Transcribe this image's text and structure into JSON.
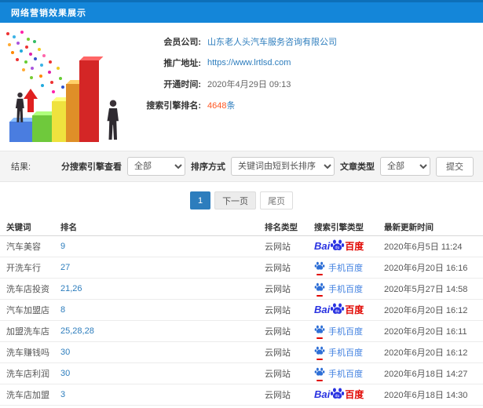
{
  "header": {
    "title": "网络营销效果展示"
  },
  "info": {
    "fields": [
      {
        "label": "会员公司:",
        "value": "山东老人头汽车服务咨询有限公司"
      },
      {
        "label": "推广地址:",
        "value": "https://www.lrtlsd.com"
      },
      {
        "label": "开通时间:",
        "value": "2020年4月29日 09:13"
      },
      {
        "label": "搜索引擎排名:",
        "value": "4648",
        "suffix": "条"
      }
    ]
  },
  "illustration": {
    "name": "3d-bar-chart-growth",
    "bar_colors": [
      "#4a7de0",
      "#6fc93c",
      "#efe23e",
      "#df8f28",
      "#d42626"
    ]
  },
  "filters": {
    "result_label": "结果:",
    "engine_label": "分搜索引擎查看",
    "engine_value": "全部",
    "sort_label": "排序方式",
    "sort_value": "关键词由短到长排序",
    "article_label": "文章类型",
    "article_value": "全部",
    "submit_label": "提交"
  },
  "pagination": {
    "current": "1",
    "next": "下一页",
    "last": "尾页"
  },
  "table": {
    "headers": [
      "关键词",
      "排名",
      "排名类型",
      "搜索引擎类型",
      "最新更新时间"
    ],
    "engine_labels": {
      "baidu_bai": "Bai",
      "baidu_du": "du",
      "baidu_cn": "百度",
      "mobile_cn": "手机百度"
    },
    "rows": [
      {
        "keyword": "汽车美容",
        "rank": "9",
        "rank_type": "云网站",
        "engine": "baidu",
        "time": "2020年6月5日 11:24"
      },
      {
        "keyword": "开洗车行",
        "rank": "27",
        "rank_type": "云网站",
        "engine": "mobile",
        "time": "2020年6月20日 16:16"
      },
      {
        "keyword": "洗车店投资",
        "rank": "21,26",
        "rank_type": "云网站",
        "engine": "mobile",
        "time": "2020年5月27日 14:58"
      },
      {
        "keyword": "汽车加盟店",
        "rank": "8",
        "rank_type": "云网站",
        "engine": "baidu",
        "time": "2020年6月20日 16:12"
      },
      {
        "keyword": "加盟洗车店",
        "rank": "25,28,28",
        "rank_type": "云网站",
        "engine": "mobile",
        "time": "2020年6月20日 16:11"
      },
      {
        "keyword": "洗车赚钱吗",
        "rank": "30",
        "rank_type": "云网站",
        "engine": "mobile",
        "time": "2020年6月20日 16:12"
      },
      {
        "keyword": "洗车店利润",
        "rank": "30",
        "rank_type": "云网站",
        "engine": "mobile",
        "time": "2020年6月18日 14:27"
      },
      {
        "keyword": "洗车店加盟",
        "rank": "3",
        "rank_type": "云网站",
        "engine": "baidu",
        "time": "2020年6月18日 14:30"
      }
    ]
  },
  "colors": {
    "header_blue": "#1486d9",
    "link_blue": "#2d7dbd",
    "highlight_orange": "#ff5722",
    "baidu_blue": "#2932e1",
    "baidu_red": "#e10601",
    "pagination_active": "#2d7dbd"
  }
}
